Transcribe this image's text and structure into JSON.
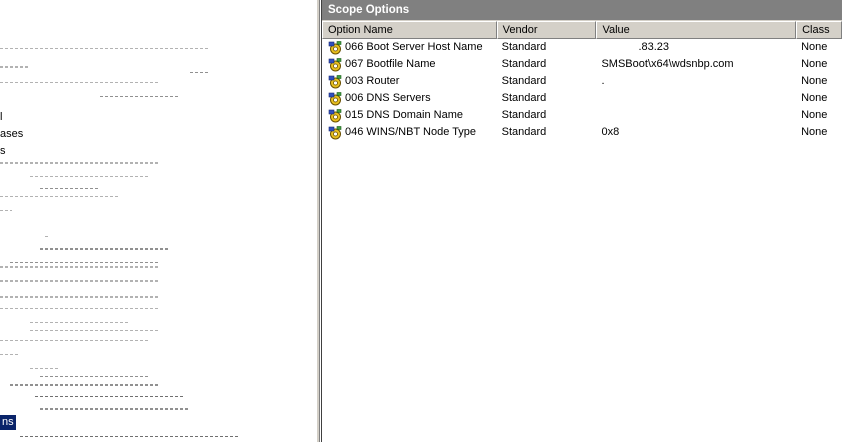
{
  "left_tree": {
    "visible_labels": [
      {
        "key": "l",
        "text": "l"
      },
      {
        "key": "ases",
        "text": "ases"
      },
      {
        "key": "s",
        "text": "s"
      },
      {
        "key": "selected",
        "text": "ns"
      }
    ]
  },
  "scope_options": {
    "title": "Scope Options",
    "columns": {
      "option_name": "Option Name",
      "vendor": "Vendor",
      "value": "Value",
      "class": "Class"
    },
    "rows": [
      {
        "icon": "dhcp-option-icon",
        "name": "066 Boot Server Host Name",
        "vendor": "Standard",
        "value": ".83.23",
        "class": "None"
      },
      {
        "icon": "dhcp-option-icon",
        "name": "067 Bootfile Name",
        "vendor": "Standard",
        "value": "SMSBoot\\x64\\wdsnbp.com",
        "class": "None"
      },
      {
        "icon": "dhcp-option-icon",
        "name": "003 Router",
        "vendor": "Standard",
        "value": ".",
        "class": "None"
      },
      {
        "icon": "dhcp-option-icon",
        "name": "006 DNS Servers",
        "vendor": "Standard",
        "value": "",
        "class": "None"
      },
      {
        "icon": "dhcp-option-icon",
        "name": "015 DNS Domain Name",
        "vendor": "Standard",
        "value": "",
        "class": "None"
      },
      {
        "icon": "dhcp-option-icon",
        "name": "046 WINS/NBT Node Type",
        "vendor": "Standard",
        "value": "0x8",
        "class": "None"
      }
    ]
  },
  "colors": {
    "title_bar": "#808080",
    "header_bg": "#d4d0c8",
    "selection": "#0a246a",
    "icon_yellow": "#e8c020",
    "icon_blue": "#3050c0"
  }
}
